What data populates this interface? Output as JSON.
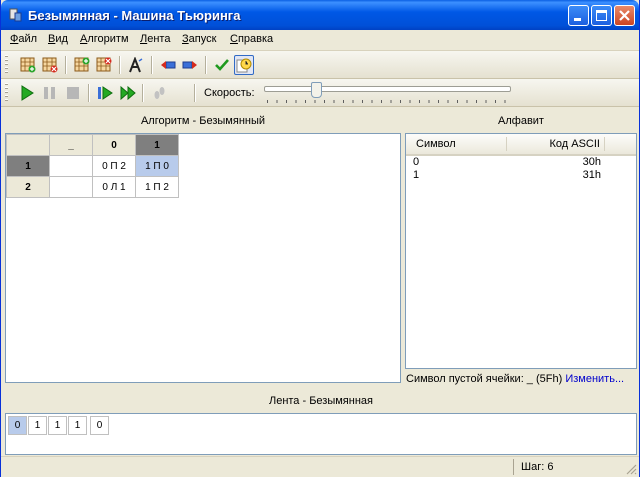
{
  "window": {
    "title": "Безымянная - Машина Тьюринга"
  },
  "menu": [
    {
      "label": "Файл",
      "mnemonic": "Ф",
      "rest": "айл"
    },
    {
      "label": "Вид",
      "mnemonic": "В",
      "rest": "ид"
    },
    {
      "label": "Алгоритм",
      "mnemonic": "А",
      "rest": "лгоритм"
    },
    {
      "label": "Лента",
      "mnemonic": "Л",
      "rest": "ента"
    },
    {
      "label": "Запуск",
      "mnemonic": "З",
      "rest": "апуск"
    },
    {
      "label": "Справка",
      "mnemonic": "С",
      "rest": "правка"
    }
  ],
  "toolbar": {
    "speed_label": "Скорость:",
    "speed_level": 0.2
  },
  "algorithm": {
    "header": "Алгоритм - Безымянный",
    "columns": [
      "_",
      "0",
      "1"
    ],
    "rows": [
      {
        "state": "1",
        "cells": [
          "",
          "0 П 2",
          "1 П 0"
        ]
      },
      {
        "state": "2",
        "cells": [
          "",
          "0 Л 1",
          "1 П 2"
        ]
      }
    ]
  },
  "alphabet": {
    "header": "Алфавит",
    "col_symbol": "Символ",
    "col_code": "Код ASCII",
    "items": [
      {
        "symbol": "0",
        "code": "30h"
      },
      {
        "symbol": "1",
        "code": "31h"
      }
    ],
    "empty_cell_label": "Символ пустой ячейки: _ (5Fh)",
    "change_link": "Изменить..."
  },
  "tape": {
    "header": "Лента - Безымянная",
    "cells": [
      "0",
      "1",
      "1",
      "1",
      "0"
    ]
  },
  "status": {
    "step": "Шаг: 6"
  }
}
